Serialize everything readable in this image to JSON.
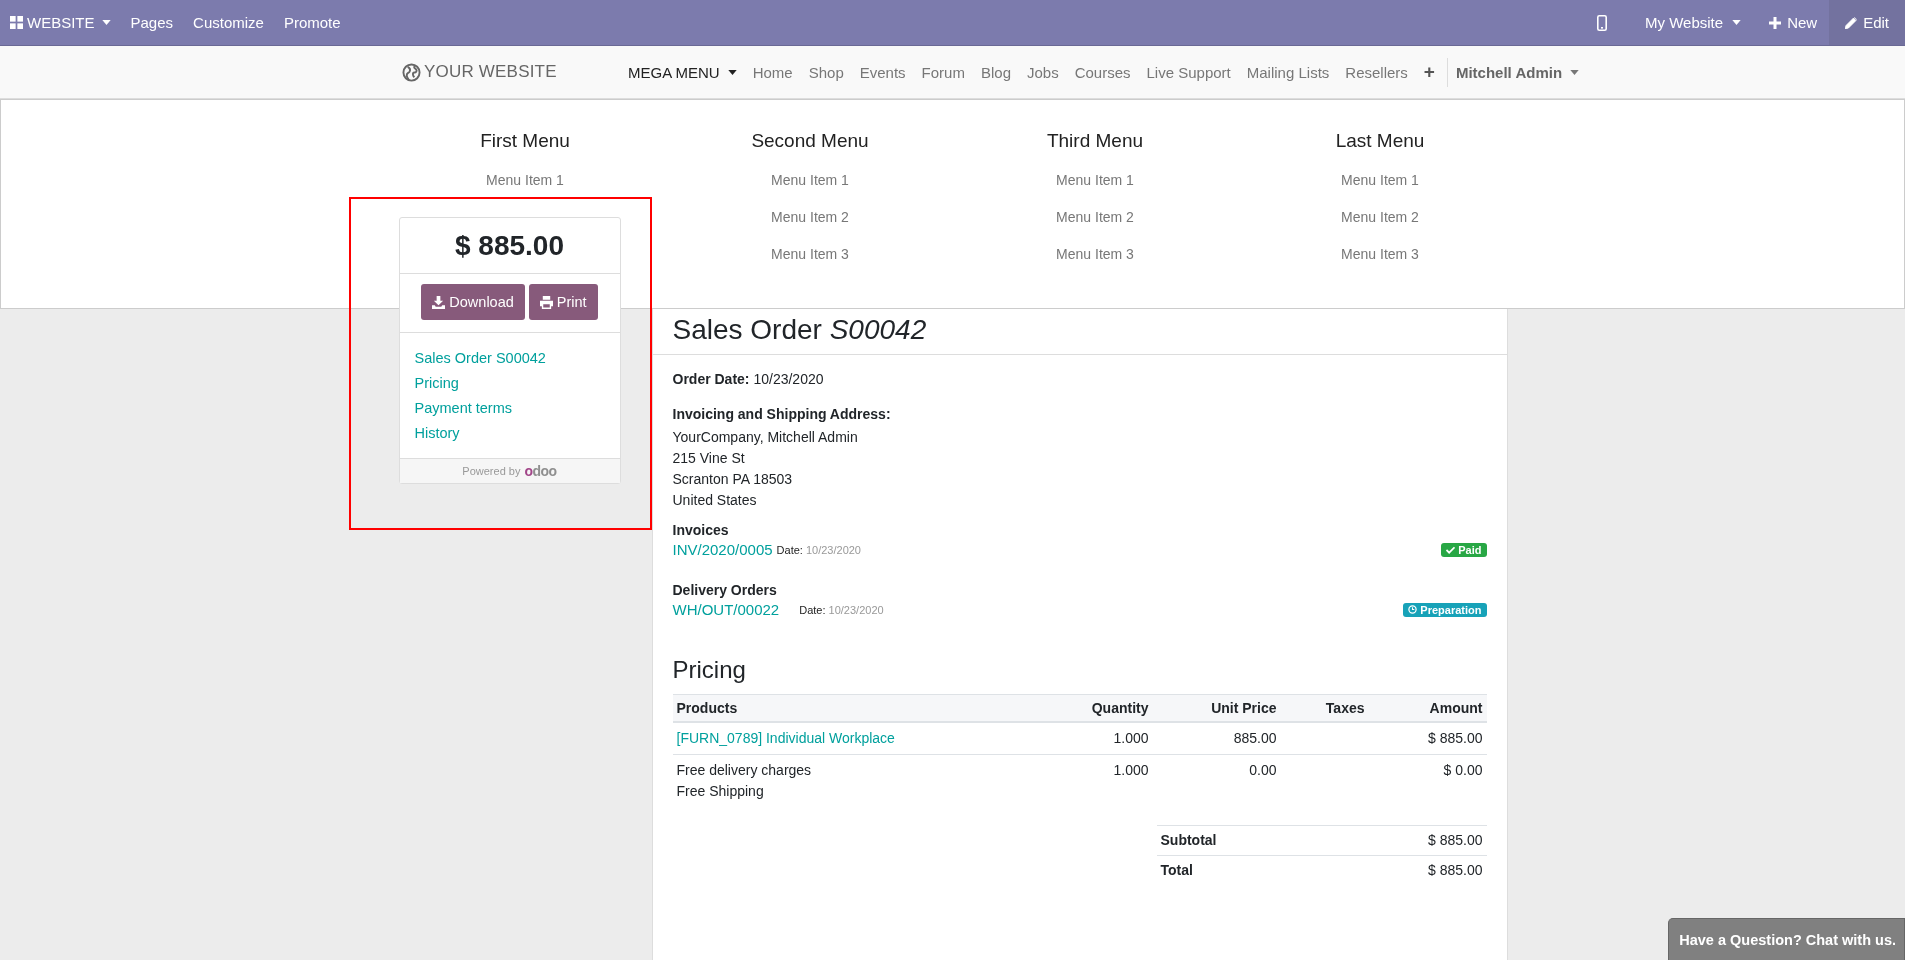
{
  "admin_bar": {
    "app": "WEBSITE",
    "menu": [
      "Pages",
      "Customize",
      "Promote"
    ],
    "website": "My Website",
    "new": "New",
    "edit": "Edit"
  },
  "navbar": {
    "logo": "YOUR WEBSITE",
    "items": [
      {
        "label": "MEGA MENU",
        "kind": "dropdown",
        "selected": true
      },
      {
        "label": "Home",
        "kind": "link",
        "selected": false
      },
      {
        "label": "Shop",
        "kind": "link",
        "selected": false
      },
      {
        "label": "Events",
        "kind": "link",
        "selected": false
      },
      {
        "label": "Forum",
        "kind": "link",
        "selected": false
      },
      {
        "label": "Blog",
        "kind": "link",
        "selected": false
      },
      {
        "label": "Jobs",
        "kind": "link",
        "selected": false
      },
      {
        "label": "Courses",
        "kind": "link",
        "selected": false
      },
      {
        "label": "Live Support",
        "kind": "link",
        "selected": false
      },
      {
        "label": "Mailing Lists",
        "kind": "link",
        "selected": false
      },
      {
        "label": "Resellers",
        "kind": "link",
        "selected": false
      },
      {
        "label": "+",
        "kind": "add",
        "selected": false
      }
    ],
    "user": "Mitchell Admin"
  },
  "mega_menu": {
    "columns": [
      {
        "title": "First Menu",
        "items": [
          "Menu Item 1"
        ]
      },
      {
        "title": "Second Menu",
        "items": [
          "Menu Item 1",
          "Menu Item 2",
          "Menu Item 3"
        ]
      },
      {
        "title": "Third Menu",
        "items": [
          "Menu Item 1",
          "Menu Item 2",
          "Menu Item 3"
        ]
      },
      {
        "title": "Last Menu",
        "items": [
          "Menu Item 1",
          "Menu Item 2",
          "Menu Item 3"
        ]
      }
    ]
  },
  "sidebar": {
    "amount": "$ 885.00",
    "buttons": [
      {
        "label": "Download",
        "kind": "download"
      },
      {
        "label": "Print",
        "kind": "print"
      }
    ],
    "links": [
      "Sales Order S00042",
      "Pricing",
      "Payment terms",
      "History"
    ],
    "powered_by": "Powered by",
    "logo": "odoo"
  },
  "order": {
    "title": "Sales Order",
    "number": "S00042",
    "order_date_label": "Order Date:",
    "order_date": "10/23/2020",
    "address_label": "Invoicing and Shipping Address:",
    "address_lines": [
      "YourCompany, Mitchell Admin",
      "215 Vine St",
      "Scranton PA 18503",
      "United States"
    ],
    "sections": [
      {
        "title": "Invoices",
        "reference": "INV/2020/0005",
        "date_label": "Date:",
        "date": "10/23/2020",
        "status": "Paid",
        "kind": "paid",
        "color": "#28a745"
      },
      {
        "title": "Delivery Orders",
        "reference": "WH/OUT/00022",
        "date_label": "Date:",
        "date": "10/23/2020",
        "status": "Preparation",
        "kind": "preparation",
        "color": "#17a2b8"
      }
    ]
  },
  "pricing": {
    "title": "Pricing",
    "columns": [
      "Products",
      "Quantity",
      "Unit Price",
      "Taxes",
      "Amount"
    ],
    "rows": [
      {
        "kind": "link",
        "product": [
          "[FURN_0789] Individual Workplace"
        ],
        "quantity": "1.000",
        "unit_price": "885.00",
        "amount": "$ 885.00"
      },
      {
        "kind": "text",
        "product": [
          "Free delivery charges",
          "Free Shipping"
        ],
        "quantity": "1.000",
        "unit_price": "0.00",
        "amount": "$ 0.00"
      }
    ],
    "totals": [
      {
        "label": "Subtotal",
        "value": "$ 885.00"
      },
      {
        "label": "Total",
        "value": "$ 885.00"
      }
    ]
  },
  "chat_button": "Have a Question? Chat with us."
}
